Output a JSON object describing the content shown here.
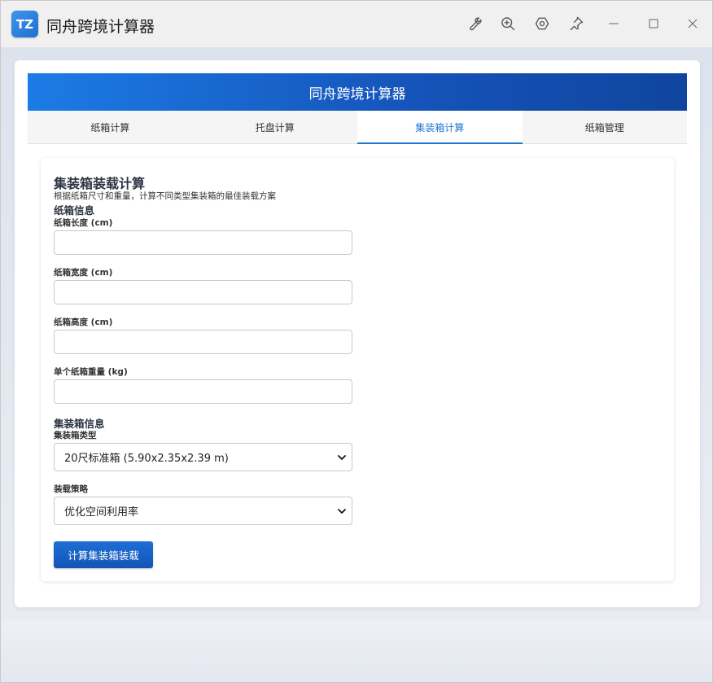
{
  "window": {
    "logo_text": "TZ",
    "title": "同舟跨境计算器"
  },
  "header": {
    "title": "同舟跨境计算器"
  },
  "tabs": [
    {
      "label": "纸箱计算",
      "active": false
    },
    {
      "label": "托盘计算",
      "active": false
    },
    {
      "label": "集装箱计算",
      "active": true
    },
    {
      "label": "纸箱管理",
      "active": false
    }
  ],
  "card": {
    "title": "集装箱装载计算",
    "subtitle": "根据纸箱尺寸和重量，计算不同类型集装箱的最佳装载方案"
  },
  "carton_section": {
    "title": "纸箱信息",
    "fields": [
      {
        "label": "纸箱长度 (cm)",
        "value": ""
      },
      {
        "label": "纸箱宽度 (cm)",
        "value": ""
      },
      {
        "label": "纸箱高度 (cm)",
        "value": ""
      },
      {
        "label": "单个纸箱重量 (kg)",
        "value": ""
      }
    ]
  },
  "container_section": {
    "title": "集装箱信息",
    "type_label": "集装箱类型",
    "type_value": "20尺标准箱 (5.90x2.35x2.39 m)",
    "strategy_label": "装载策略",
    "strategy_value": "优化空间利用率"
  },
  "actions": {
    "calculate_label": "计算集装箱装载"
  },
  "colors": {
    "accent": "#1f76d2",
    "banner_start": "#1c7be6",
    "banner_end": "#0f459f"
  }
}
